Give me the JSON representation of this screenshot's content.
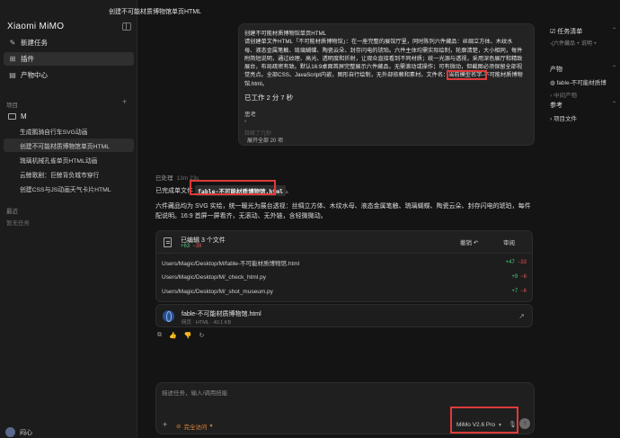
{
  "sidebar": {
    "brand": "Xiaomi MiMO",
    "nav": [
      {
        "label": "新建任务",
        "icon": "✎"
      },
      {
        "label": "插件",
        "icon": "⊞"
      },
      {
        "label": "产物中心",
        "icon": "▤"
      }
    ],
    "projects_label": "项目",
    "project_name": "M",
    "tasks": [
      "生成鹅骑自行车SVG动画",
      "创建不可能材质博物馆单页HTML",
      "琉璃机械孔雀单页HTML动画",
      "云鲸歌剧：巨鲸背负城市穿行",
      "创建CSS与JS动画天气卡片HTML"
    ],
    "recent_label": "最近",
    "empty_text": "暂无任务",
    "user_name": "闷心"
  },
  "conversation": {
    "title": "创建不可能材质博物馆单页HTML",
    "user_message": [
      "创建不可能材质博物馆单页HTML",
      "请创建单文件HTML「不可能材质博物馆」：在一座完整的展馆厅里，同时陈列六件藏品：丝绸立方体、木纹水",
      "母、液态金属笔触、琉璃蝴蝶、陶瓷云朵、封存闪电的琥珀。六件主体均需实际绘制，轮廓清楚，大小相同，每件",
      "附简短说明，通过纹理、高光、透明度和折射，让观众直接看到不同材质；统一光源与透视，采用深色展厅和精致",
      "展台，布局疏密有致。默认16:9桌面首屏完整展示六件藏品，无需滚动或操作；可有微动，但截图必须保留全部视",
      "觉亮点。全部CSS、JavaScript内嵌，图形自行绘制，无外部依赖和素材。文件名：当前模型名字-不可能材质博物",
      "馆.html。"
    ],
    "worked_time": "已工作 2 分 7 秒",
    "think_label": "思考",
    "think_dots": "•",
    "think_sub": "持续了几秒",
    "expand_label": "展开全部 20 项",
    "done_label": "已处理",
    "done_time": "13m 23s",
    "reply_prefix": "已完成单文件",
    "reply_file": "fable-不可能材质博物馆.html",
    "reply_suffix": "。",
    "description": "六件藏品均为 SVG 实绘，统一暖光为展台透视：丝绸立方体、木纹水母、液态金属笔触、琉璃蝴蝶、陶瓷云朵、封存闪电的琥珀，每件配说明。16:9 首屏一屏看齐，无滚动、无外链，含轻微微动。"
  },
  "edits": {
    "title": "已编辑 3 个文件",
    "added": "+63",
    "removed": "−39",
    "undo_label": "撤销 ↶",
    "review_label": "审阅",
    "files": [
      {
        "path": "Users/Magic/Desktop/M/fable-不可能材质博物馆.html",
        "added": "+47",
        "removed": "−33"
      },
      {
        "path": "Users/Magic/Desktop/M/_check_html.py",
        "added": "+9",
        "removed": "−6"
      },
      {
        "path": "Users/Magic/Desktop/M/_shot_museum.py",
        "added": "+7",
        "removed": "−6"
      }
    ]
  },
  "artifact": {
    "name": "fable-不可能材质博物馆.html",
    "meta": "网页 · HTML · 40.1 KB"
  },
  "actions": [
    "⧉",
    "👍",
    "👎",
    "↻"
  ],
  "composer": {
    "placeholder": "描述任务，输入/调用技能",
    "plus": "+",
    "access_label": "完全访问",
    "model": "MiMo V2.6 Pro",
    "mic": "🎙",
    "send": "↑"
  },
  "right_panel": {
    "tasks_title": "任务清单",
    "tasks_sub": "-(六件藏品 + 说明 +",
    "output_title": "产物",
    "output_item": "fable-不可能材质博",
    "output_sub": "中间产物",
    "ref_title": "参考",
    "ref_item": "项目文件"
  },
  "colors": {
    "highlight": "#e03a3a",
    "accent_orange": "#e0843a",
    "added": "#4ec97a",
    "removed": "#e05555"
  }
}
